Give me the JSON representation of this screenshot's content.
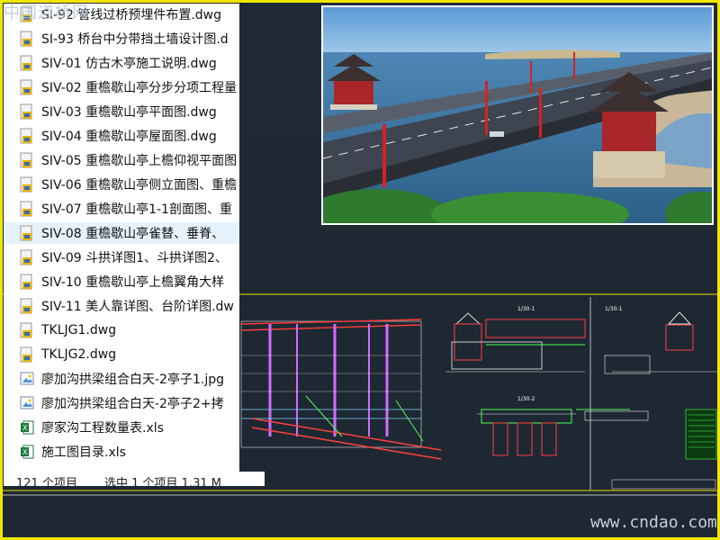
{
  "files": [
    {
      "name": "SI-92 管线过桥预埋件布置.dwg",
      "type": "dwg"
    },
    {
      "name": "SI-93 桥台中分带挡土墙设计图.d",
      "type": "dwg"
    },
    {
      "name": "SIV-01 仿古木亭施工说明.dwg",
      "type": "dwg"
    },
    {
      "name": "SIV-02 重檐歇山亭分步分项工程量",
      "type": "dwg"
    },
    {
      "name": "SIV-03 重檐歇山亭平面图.dwg",
      "type": "dwg"
    },
    {
      "name": "SIV-04 重檐歇山亭屋面图.dwg",
      "type": "dwg"
    },
    {
      "name": "SIV-05 重檐歇山亭上檐仰视平面图",
      "type": "dwg"
    },
    {
      "name": "SIV-06 重檐歇山亭侧立面图、重檐",
      "type": "dwg"
    },
    {
      "name": "SIV-07 重檐歇山亭1-1剖面图、重",
      "type": "dwg"
    },
    {
      "name": "SIV-08 重檐歇山亭雀替、垂脊、",
      "type": "dwg",
      "selected": true
    },
    {
      "name": "SIV-09 斗拱详图1、斗拱详图2、",
      "type": "dwg"
    },
    {
      "name": "SIV-10 重檐歇山亭上檐翼角大样",
      "type": "dwg"
    },
    {
      "name": "SIV-11 美人靠详图、台阶详图.dw",
      "type": "dwg"
    },
    {
      "name": "TKLJG1.dwg",
      "type": "dwg"
    },
    {
      "name": "TKLJG2.dwg",
      "type": "dwg"
    },
    {
      "name": "廖加沟拱梁组合白天-2亭子1.jpg",
      "type": "jpg"
    },
    {
      "name": "廖加沟拱梁组合白天-2亭子2+拷",
      "type": "jpg"
    },
    {
      "name": "廖家沟工程数量表.xls",
      "type": "xls"
    },
    {
      "name": "施工图目录.xls",
      "type": "xls"
    }
  ],
  "status": {
    "count": "121 个项目",
    "selected": "选中 1 个项目 1.31 M"
  },
  "watermarks": {
    "top": "中国道桥网",
    "bottom": "www.cndao.com"
  },
  "cad": {
    "section_labels": [
      "1/30-1",
      "1/30-1",
      "1/30-2"
    ]
  },
  "colors": {
    "frame": "#f2e600",
    "cad_background": "#1e2833",
    "selected_row": "#e5f1fb"
  }
}
